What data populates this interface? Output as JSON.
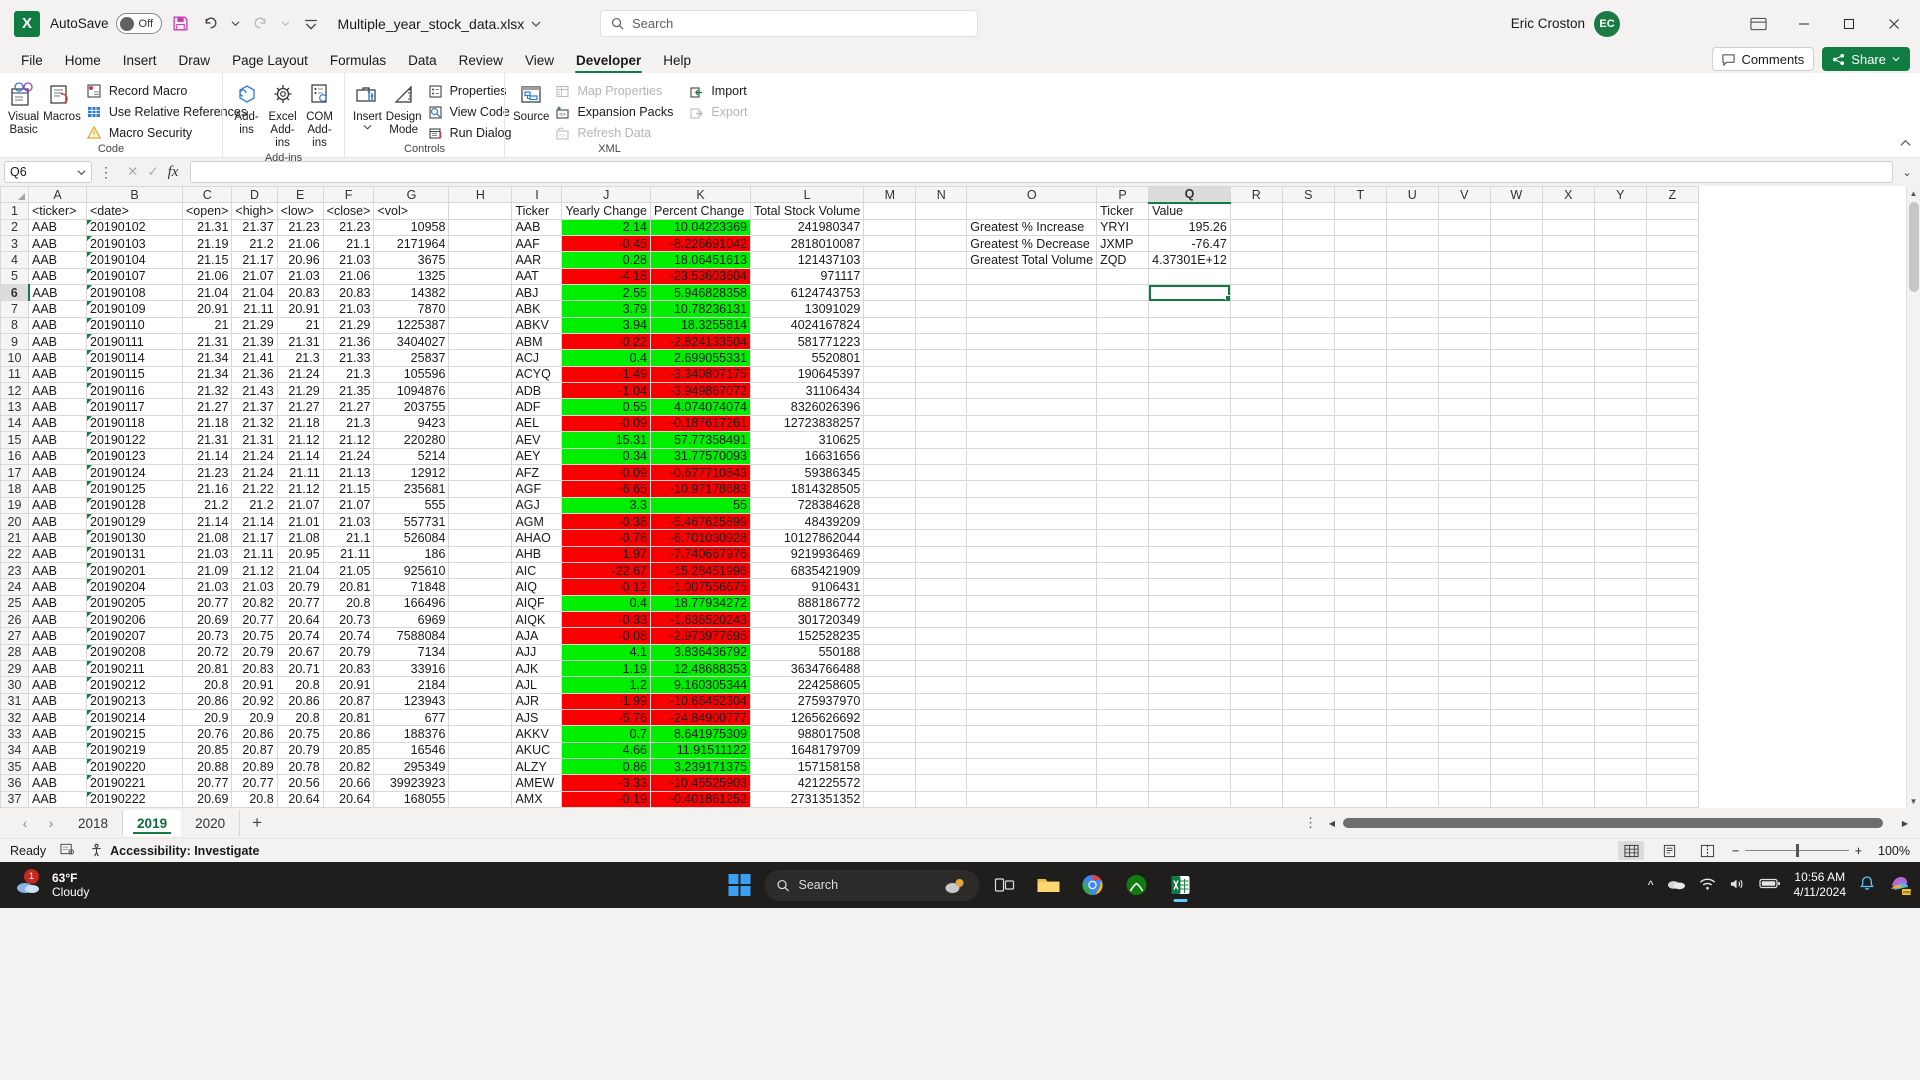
{
  "titlebar": {
    "autosave_label": "AutoSave",
    "autosave_state": "Off",
    "document_name": "Multiple_year_stock_data.xlsx",
    "search_placeholder": "Search",
    "account_name": "Eric Croston",
    "account_initials": "EC"
  },
  "menu": {
    "tabs": [
      "File",
      "Home",
      "Insert",
      "Draw",
      "Page Layout",
      "Formulas",
      "Data",
      "Review",
      "View",
      "Developer",
      "Help"
    ],
    "active_tab": "Developer",
    "comments_label": "Comments",
    "share_label": "Share"
  },
  "ribbon": {
    "groups": [
      {
        "name": "Code",
        "big_buttons": [
          {
            "label": "Visual Basic",
            "icon": "visual-basic-icon"
          },
          {
            "label": "Macros",
            "icon": "macros-icon"
          }
        ],
        "small_buttons": [
          {
            "label": "Record Macro",
            "icon": "record-macro-icon",
            "disabled": false
          },
          {
            "label": "Use Relative References",
            "icon": "relative-references-icon",
            "disabled": false
          },
          {
            "label": "Macro Security",
            "icon": "macro-security-icon",
            "disabled": false
          }
        ]
      },
      {
        "name": "Add-ins",
        "big_buttons": [
          {
            "label": "Add-ins",
            "icon": "add-ins-icon"
          },
          {
            "label": "Excel Add-ins",
            "icon": "excel-add-ins-icon"
          },
          {
            "label": "COM Add-ins",
            "icon": "com-add-ins-icon"
          }
        ],
        "small_buttons": []
      },
      {
        "name": "Controls",
        "big_buttons": [
          {
            "label": "Insert",
            "icon": "insert-control-icon"
          },
          {
            "label": "Design Mode",
            "icon": "design-mode-icon"
          }
        ],
        "small_buttons": [
          {
            "label": "Properties",
            "icon": "properties-icon",
            "disabled": false
          },
          {
            "label": "View Code",
            "icon": "view-code-icon",
            "disabled": false
          },
          {
            "label": "Run Dialog",
            "icon": "run-dialog-icon",
            "disabled": false
          }
        ]
      },
      {
        "name": "XML",
        "big_buttons": [
          {
            "label": "Source",
            "icon": "source-icon"
          }
        ],
        "small_buttons": [
          {
            "label": "Map Properties",
            "icon": "map-properties-icon",
            "disabled": true
          },
          {
            "label": "Expansion Packs",
            "icon": "expansion-packs-icon",
            "disabled": false
          },
          {
            "label": "Refresh Data",
            "icon": "refresh-data-icon",
            "disabled": true
          }
        ],
        "small_buttons_2": [
          {
            "label": "Import",
            "icon": "import-icon",
            "disabled": false
          },
          {
            "label": "Export",
            "icon": "export-icon",
            "disabled": true
          }
        ]
      }
    ]
  },
  "formula_bar": {
    "name_box": "Q6",
    "formula_value": ""
  },
  "grid": {
    "columns": [
      "A",
      "B",
      "C",
      "D",
      "E",
      "F",
      "G",
      "H",
      "I",
      "J",
      "K",
      "L",
      "M",
      "N",
      "O",
      "P",
      "Q",
      "R",
      "S",
      "T",
      "U",
      "V",
      "W",
      "X",
      "Y",
      "Z"
    ],
    "selected_column": "Q",
    "selected_row": 6,
    "selected_cell": "Q6",
    "headers_row1": {
      "A": "<ticker>",
      "B": "<date>",
      "C": "<open>",
      "D": "<high>",
      "E": "<low>",
      "F": "<close>",
      "G": "<vol>",
      "I": "Ticker",
      "J": "Yearly Change",
      "K": "Percent Change",
      "L": "Total Stock Volume",
      "P": "Ticker",
      "Q": "Value"
    },
    "left_rows": [
      {
        "row": 2,
        "ticker": "AAB",
        "date": "20190102",
        "open": "21.31",
        "high": "21.37",
        "low": "21.23",
        "close": "21.23",
        "vol": "10958"
      },
      {
        "row": 3,
        "ticker": "AAB",
        "date": "20190103",
        "open": "21.19",
        "high": "21.2",
        "low": "21.06",
        "close": "21.1",
        "vol": "2171964"
      },
      {
        "row": 4,
        "ticker": "AAB",
        "date": "20190104",
        "open": "21.15",
        "high": "21.17",
        "low": "20.96",
        "close": "21.03",
        "vol": "3675"
      },
      {
        "row": 5,
        "ticker": "AAB",
        "date": "20190107",
        "open": "21.06",
        "high": "21.07",
        "low": "21.03",
        "close": "21.06",
        "vol": "1325"
      },
      {
        "row": 6,
        "ticker": "AAB",
        "date": "20190108",
        "open": "21.04",
        "high": "21.04",
        "low": "20.83",
        "close": "20.83",
        "vol": "14382"
      },
      {
        "row": 7,
        "ticker": "AAB",
        "date": "20190109",
        "open": "20.91",
        "high": "21.11",
        "low": "20.91",
        "close": "21.03",
        "vol": "7870"
      },
      {
        "row": 8,
        "ticker": "AAB",
        "date": "20190110",
        "open": "21",
        "high": "21.29",
        "low": "21",
        "close": "21.29",
        "vol": "1225387"
      },
      {
        "row": 9,
        "ticker": "AAB",
        "date": "20190111",
        "open": "21.31",
        "high": "21.39",
        "low": "21.31",
        "close": "21.36",
        "vol": "3404027"
      },
      {
        "row": 10,
        "ticker": "AAB",
        "date": "20190114",
        "open": "21.34",
        "high": "21.41",
        "low": "21.3",
        "close": "21.33",
        "vol": "25837"
      },
      {
        "row": 11,
        "ticker": "AAB",
        "date": "20190115",
        "open": "21.34",
        "high": "21.36",
        "low": "21.24",
        "close": "21.3",
        "vol": "105596"
      },
      {
        "row": 12,
        "ticker": "AAB",
        "date": "20190116",
        "open": "21.32",
        "high": "21.43",
        "low": "21.29",
        "close": "21.35",
        "vol": "1094876"
      },
      {
        "row": 13,
        "ticker": "AAB",
        "date": "20190117",
        "open": "21.27",
        "high": "21.37",
        "low": "21.27",
        "close": "21.27",
        "vol": "203755"
      },
      {
        "row": 14,
        "ticker": "AAB",
        "date": "20190118",
        "open": "21.18",
        "high": "21.32",
        "low": "21.18",
        "close": "21.3",
        "vol": "9423"
      },
      {
        "row": 15,
        "ticker": "AAB",
        "date": "20190122",
        "open": "21.31",
        "high": "21.31",
        "low": "21.12",
        "close": "21.12",
        "vol": "220280"
      },
      {
        "row": 16,
        "ticker": "AAB",
        "date": "20190123",
        "open": "21.14",
        "high": "21.24",
        "low": "21.14",
        "close": "21.24",
        "vol": "5214"
      },
      {
        "row": 17,
        "ticker": "AAB",
        "date": "20190124",
        "open": "21.23",
        "high": "21.24",
        "low": "21.11",
        "close": "21.13",
        "vol": "12912"
      },
      {
        "row": 18,
        "ticker": "AAB",
        "date": "20190125",
        "open": "21.16",
        "high": "21.22",
        "low": "21.12",
        "close": "21.15",
        "vol": "235681"
      },
      {
        "row": 19,
        "ticker": "AAB",
        "date": "20190128",
        "open": "21.2",
        "high": "21.2",
        "low": "21.07",
        "close": "21.07",
        "vol": "555"
      },
      {
        "row": 20,
        "ticker": "AAB",
        "date": "20190129",
        "open": "21.14",
        "high": "21.14",
        "low": "21.01",
        "close": "21.03",
        "vol": "557731"
      },
      {
        "row": 21,
        "ticker": "AAB",
        "date": "20190130",
        "open": "21.08",
        "high": "21.17",
        "low": "21.08",
        "close": "21.1",
        "vol": "526084"
      },
      {
        "row": 22,
        "ticker": "AAB",
        "date": "20190131",
        "open": "21.03",
        "high": "21.11",
        "low": "20.95",
        "close": "21.11",
        "vol": "186"
      },
      {
        "row": 23,
        "ticker": "AAB",
        "date": "20190201",
        "open": "21.09",
        "high": "21.12",
        "low": "21.04",
        "close": "21.05",
        "vol": "925610"
      },
      {
        "row": 24,
        "ticker": "AAB",
        "date": "20190204",
        "open": "21.03",
        "high": "21.03",
        "low": "20.79",
        "close": "20.81",
        "vol": "71848"
      },
      {
        "row": 25,
        "ticker": "AAB",
        "date": "20190205",
        "open": "20.77",
        "high": "20.82",
        "low": "20.77",
        "close": "20.8",
        "vol": "166496"
      },
      {
        "row": 26,
        "ticker": "AAB",
        "date": "20190206",
        "open": "20.69",
        "high": "20.77",
        "low": "20.64",
        "close": "20.73",
        "vol": "6969"
      },
      {
        "row": 27,
        "ticker": "AAB",
        "date": "20190207",
        "open": "20.73",
        "high": "20.75",
        "low": "20.74",
        "close": "20.74",
        "vol": "7588084"
      },
      {
        "row": 28,
        "ticker": "AAB",
        "date": "20190208",
        "open": "20.72",
        "high": "20.79",
        "low": "20.67",
        "close": "20.79",
        "vol": "7134"
      },
      {
        "row": 29,
        "ticker": "AAB",
        "date": "20190211",
        "open": "20.81",
        "high": "20.83",
        "low": "20.71",
        "close": "20.83",
        "vol": "33916"
      },
      {
        "row": 30,
        "ticker": "AAB",
        "date": "20190212",
        "open": "20.8",
        "high": "20.91",
        "low": "20.8",
        "close": "20.91",
        "vol": "2184"
      },
      {
        "row": 31,
        "ticker": "AAB",
        "date": "20190213",
        "open": "20.86",
        "high": "20.92",
        "low": "20.86",
        "close": "20.87",
        "vol": "123943"
      },
      {
        "row": 32,
        "ticker": "AAB",
        "date": "20190214",
        "open": "20.9",
        "high": "20.9",
        "low": "20.8",
        "close": "20.81",
        "vol": "677"
      },
      {
        "row": 33,
        "ticker": "AAB",
        "date": "20190215",
        "open": "20.76",
        "high": "20.86",
        "low": "20.75",
        "close": "20.86",
        "vol": "188376"
      },
      {
        "row": 34,
        "ticker": "AAB",
        "date": "20190219",
        "open": "20.85",
        "high": "20.87",
        "low": "20.79",
        "close": "20.85",
        "vol": "16546"
      },
      {
        "row": 35,
        "ticker": "AAB",
        "date": "20190220",
        "open": "20.88",
        "high": "20.89",
        "low": "20.78",
        "close": "20.82",
        "vol": "295349"
      },
      {
        "row": 36,
        "ticker": "AAB",
        "date": "20190221",
        "open": "20.77",
        "high": "20.77",
        "low": "20.56",
        "close": "20.66",
        "vol": "39923923"
      },
      {
        "row": 37,
        "ticker": "AAB",
        "date": "20190222",
        "open": "20.69",
        "high": "20.8",
        "low": "20.64",
        "close": "20.64",
        "vol": "168055"
      }
    ],
    "analysis_rows": [
      {
        "row": 2,
        "ticker": "AAB",
        "yearly_change": "2.14",
        "percent_change": "10.04223369",
        "positive": true,
        "volume": "241980347"
      },
      {
        "row": 3,
        "ticker": "AAF",
        "yearly_change": "-0.45",
        "percent_change": "-8.226691042",
        "positive": false,
        "volume": "2818010087"
      },
      {
        "row": 4,
        "ticker": "AAR",
        "yearly_change": "0.28",
        "percent_change": "18.06451613",
        "positive": true,
        "volume": "121437103"
      },
      {
        "row": 5,
        "ticker": "AAT",
        "yearly_change": "-4.18",
        "percent_change": "-23.53603604",
        "positive": false,
        "volume": "971117"
      },
      {
        "row": 6,
        "ticker": "ABJ",
        "yearly_change": "2.55",
        "percent_change": "5.946828358",
        "positive": true,
        "volume": "6124743753"
      },
      {
        "row": 7,
        "ticker": "ABK",
        "yearly_change": "3.79",
        "percent_change": "10.78236131",
        "positive": true,
        "volume": "13091029"
      },
      {
        "row": 8,
        "ticker": "ABKV",
        "yearly_change": "3.94",
        "percent_change": "18.3255814",
        "positive": true,
        "volume": "4024167824"
      },
      {
        "row": 9,
        "ticker": "ABM",
        "yearly_change": "-0.22",
        "percent_change": "-2.824133504",
        "positive": false,
        "volume": "581771223"
      },
      {
        "row": 10,
        "ticker": "ACJ",
        "yearly_change": "0.4",
        "percent_change": "2.699055331",
        "positive": true,
        "volume": "5520801"
      },
      {
        "row": 11,
        "ticker": "ACYQ",
        "yearly_change": "-1.49",
        "percent_change": "-3.340807175",
        "positive": false,
        "volume": "190645397"
      },
      {
        "row": 12,
        "ticker": "ADB",
        "yearly_change": "-1.04",
        "percent_change": "-3.949867072",
        "positive": false,
        "volume": "31106434"
      },
      {
        "row": 13,
        "ticker": "ADF",
        "yearly_change": "0.55",
        "percent_change": "4.074074074",
        "positive": true,
        "volume": "8326026396"
      },
      {
        "row": 14,
        "ticker": "AEL",
        "yearly_change": "-0.09",
        "percent_change": "-0.187617261",
        "positive": false,
        "volume": "12723838257"
      },
      {
        "row": 15,
        "ticker": "AEV",
        "yearly_change": "15.31",
        "percent_change": "57.77358491",
        "positive": true,
        "volume": "310625"
      },
      {
        "row": 16,
        "ticker": "AEY",
        "yearly_change": "0.34",
        "percent_change": "31.77570093",
        "positive": true,
        "volume": "16631656"
      },
      {
        "row": 17,
        "ticker": "AFZ",
        "yearly_change": "-0.09",
        "percent_change": "-0.677710843",
        "positive": false,
        "volume": "59386345"
      },
      {
        "row": 18,
        "ticker": "AGF",
        "yearly_change": "-6.65",
        "percent_change": "-10.97178683",
        "positive": false,
        "volume": "1814328505"
      },
      {
        "row": 19,
        "ticker": "AGJ",
        "yearly_change": "3.3",
        "percent_change": "55",
        "positive": true,
        "volume": "728384628"
      },
      {
        "row": 20,
        "ticker": "AGM",
        "yearly_change": "-0.38",
        "percent_change": "-5.467625899",
        "positive": false,
        "volume": "48439209"
      },
      {
        "row": 21,
        "ticker": "AHAO",
        "yearly_change": "-0.78",
        "percent_change": "-6.701030928",
        "positive": false,
        "volume": "10127862044"
      },
      {
        "row": 22,
        "ticker": "AHB",
        "yearly_change": "1.97",
        "percent_change": "-7.740667976",
        "positive": false,
        "volume": "9219936469"
      },
      {
        "row": 23,
        "ticker": "AIC",
        "yearly_change": "-22.67",
        "percent_change": "-15.28451996",
        "positive": false,
        "volume": "6835421909"
      },
      {
        "row": 24,
        "ticker": "AIQ",
        "yearly_change": "-0.12",
        "percent_change": "-1.007556675",
        "positive": false,
        "volume": "9106431"
      },
      {
        "row": 25,
        "ticker": "AIQF",
        "yearly_change": "0.4",
        "percent_change": "18.77934272",
        "positive": true,
        "volume": "888186772"
      },
      {
        "row": 26,
        "ticker": "AIQK",
        "yearly_change": "-0.33",
        "percent_change": "-1.636520243",
        "positive": false,
        "volume": "301720349"
      },
      {
        "row": 27,
        "ticker": "AJA",
        "yearly_change": "-0.08",
        "percent_change": "-2.973977695",
        "positive": false,
        "volume": "152528235"
      },
      {
        "row": 28,
        "ticker": "AJJ",
        "yearly_change": "4.1",
        "percent_change": "3.836436792",
        "positive": true,
        "volume": "550188"
      },
      {
        "row": 29,
        "ticker": "AJK",
        "yearly_change": "1.19",
        "percent_change": "12.48688353",
        "positive": true,
        "volume": "3634766488"
      },
      {
        "row": 30,
        "ticker": "AJL",
        "yearly_change": "1.2",
        "percent_change": "9.160305344",
        "positive": true,
        "volume": "224258605"
      },
      {
        "row": 31,
        "ticker": "AJR",
        "yearly_change": "-1.99",
        "percent_change": "-10.66452304",
        "positive": false,
        "volume": "275937970"
      },
      {
        "row": 32,
        "ticker": "AJS",
        "yearly_change": "-5.76",
        "percent_change": "-24.84900777",
        "positive": false,
        "volume": "1265626692"
      },
      {
        "row": 33,
        "ticker": "AKKV",
        "yearly_change": "0.7",
        "percent_change": "8.641975309",
        "positive": true,
        "volume": "988017508"
      },
      {
        "row": 34,
        "ticker": "AKUC",
        "yearly_change": "4.66",
        "percent_change": "11.91511122",
        "positive": true,
        "volume": "1648179709"
      },
      {
        "row": 35,
        "ticker": "ALZY",
        "yearly_change": "0.86",
        "percent_change": "3.239171375",
        "positive": true,
        "volume": "157158158"
      },
      {
        "row": 36,
        "ticker": "AMEW",
        "yearly_change": "-3.33",
        "percent_change": "-10.45525903",
        "positive": false,
        "volume": "421225572"
      },
      {
        "row": 37,
        "ticker": "AMX",
        "yearly_change": "-0.19",
        "percent_change": "-0.401861252",
        "positive": false,
        "volume": "2731351352"
      }
    ],
    "summary": {
      "header_ticker": "Ticker",
      "header_value": "Value",
      "rows": [
        {
          "row": 2,
          "label": "Greatest % Increase",
          "ticker": "YRYI",
          "value": "195.26"
        },
        {
          "row": 3,
          "label": "Greatest % Decrease",
          "ticker": "JXMP",
          "value": "-76.47"
        },
        {
          "row": 4,
          "label": "Greatest Total Volume",
          "ticker": "ZQD",
          "value": "4.37301E+12"
        }
      ]
    }
  },
  "sheets": {
    "tabs": [
      "2018",
      "2019",
      "2020"
    ],
    "active": "2019",
    "add_label": "+"
  },
  "status_bar": {
    "status": "Ready",
    "accessibility": "Accessibility: Investigate",
    "zoom": "100%"
  },
  "taskbar": {
    "weather_temp": "63°F",
    "weather_desc": "Cloudy",
    "weather_badge": "1",
    "search_label": "Search",
    "time": "10:56 AM",
    "date": "4/11/2024"
  },
  "colors": {
    "excel_green": "#107c41",
    "positive_green": "#00ee00",
    "negative_red": "#f90000"
  }
}
